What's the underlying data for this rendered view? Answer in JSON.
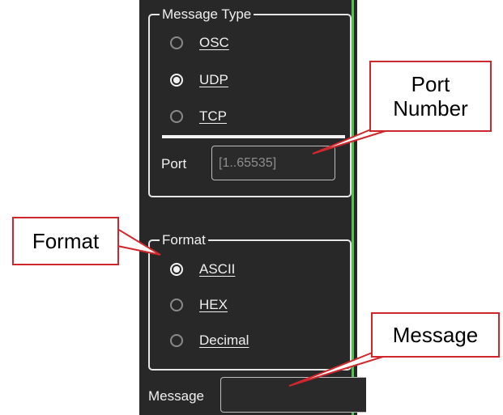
{
  "message_type_group": {
    "legend": "Message Type",
    "options": [
      {
        "label": "OSC",
        "selected": false
      },
      {
        "label": "UDP",
        "selected": true
      },
      {
        "label": "TCP",
        "selected": false
      }
    ],
    "port_label": "Port",
    "port_placeholder": "[1..65535]"
  },
  "format_group": {
    "legend": "Format",
    "options": [
      {
        "label": "ASCII",
        "selected": true
      },
      {
        "label": "HEX",
        "selected": false
      },
      {
        "label": "Decimal",
        "selected": false
      }
    ]
  },
  "message_label": "Message",
  "message_value": "",
  "callouts": {
    "port_number": "Port Number",
    "format": "Format",
    "message": "Message"
  },
  "colors": {
    "panel_background": "#282828",
    "callout_border": "#d0272d",
    "panel_edge": "#4fc24f"
  }
}
